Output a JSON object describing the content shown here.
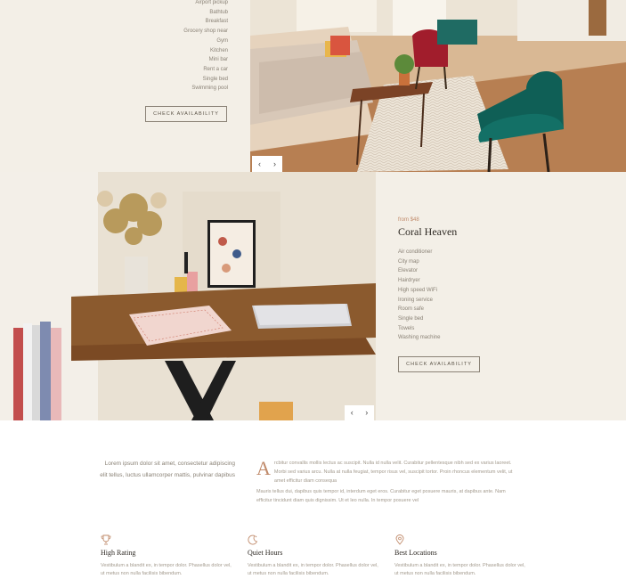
{
  "top_room": {
    "amenities": [
      "Airport pickup",
      "Bathtub",
      "Breakfast",
      "Grocery shop near",
      "Gym",
      "Kitchen",
      "Mini bar",
      "Rent a car",
      "Single bed",
      "Swimming pool"
    ],
    "cta_label": "CHECK AVAILABILITY"
  },
  "mid_room": {
    "price": "from $48",
    "title": "Coral Heaven",
    "amenities": [
      "Air conditioner",
      "City map",
      "Elevator",
      "Hairdryer",
      "High speed WiFi",
      "Ironing service",
      "Room safe",
      "Single bed",
      "Towels",
      "Washing machine"
    ],
    "cta_label": "CHECK AVAILABILITY"
  },
  "slider": {
    "prev": "‹",
    "next": "›"
  },
  "intro": {
    "left_text": "Lorem ipsum dolor sit amet, consectetur adipiscing elit tellus, luctus ullamcorper mattis, pulvinar dapibus",
    "dropcap": "A",
    "right_text_1": "rcbitur convallis mollis lectus ac suscipit. Nulla id nulla velit. Curabitur pellentesque nibh sed ex varius laoreet. Morbi sed varius arcu. Nulla at nulla feugiat, tempor risus vel, suscipit tortor. Proin rhoncus elementum velit, ut amet efficitur diam consequa",
    "right_text_2": "Mauris tellus dui, dapibus quis tempor id, interdum eget eros. Curabitur eget posuere mauris, at dapibus ante. Nam efficitur tincidunt diam quis dignissim. Ut et leo nulla. In tempor posuere vel"
  },
  "features": [
    {
      "icon": "trophy-icon",
      "title": "High Rating",
      "text": "Vestibulum a blandit ex, in tempor dolor. Phasellus dolor vel, ut metus non nulla facilisis bibendum."
    },
    {
      "icon": "moon-clock-icon",
      "title": "Quiet Hours",
      "text": "Vestibulum a blandit ex, in tempor dolor. Phasellus dolor vel, ut metus non nulla facilisis bibendum."
    },
    {
      "icon": "location-pin-icon",
      "title": "Best Locations",
      "text": "Vestibulum a blandit ex, in tempor dolor. Phasellus dolor vel, ut metus non nulla facilisis bibendum."
    }
  ],
  "colors": {
    "panel_bg": "#f3efe7",
    "accent": "#c08a6a",
    "heading": "#2f2a24",
    "muted": "#8a8276"
  }
}
